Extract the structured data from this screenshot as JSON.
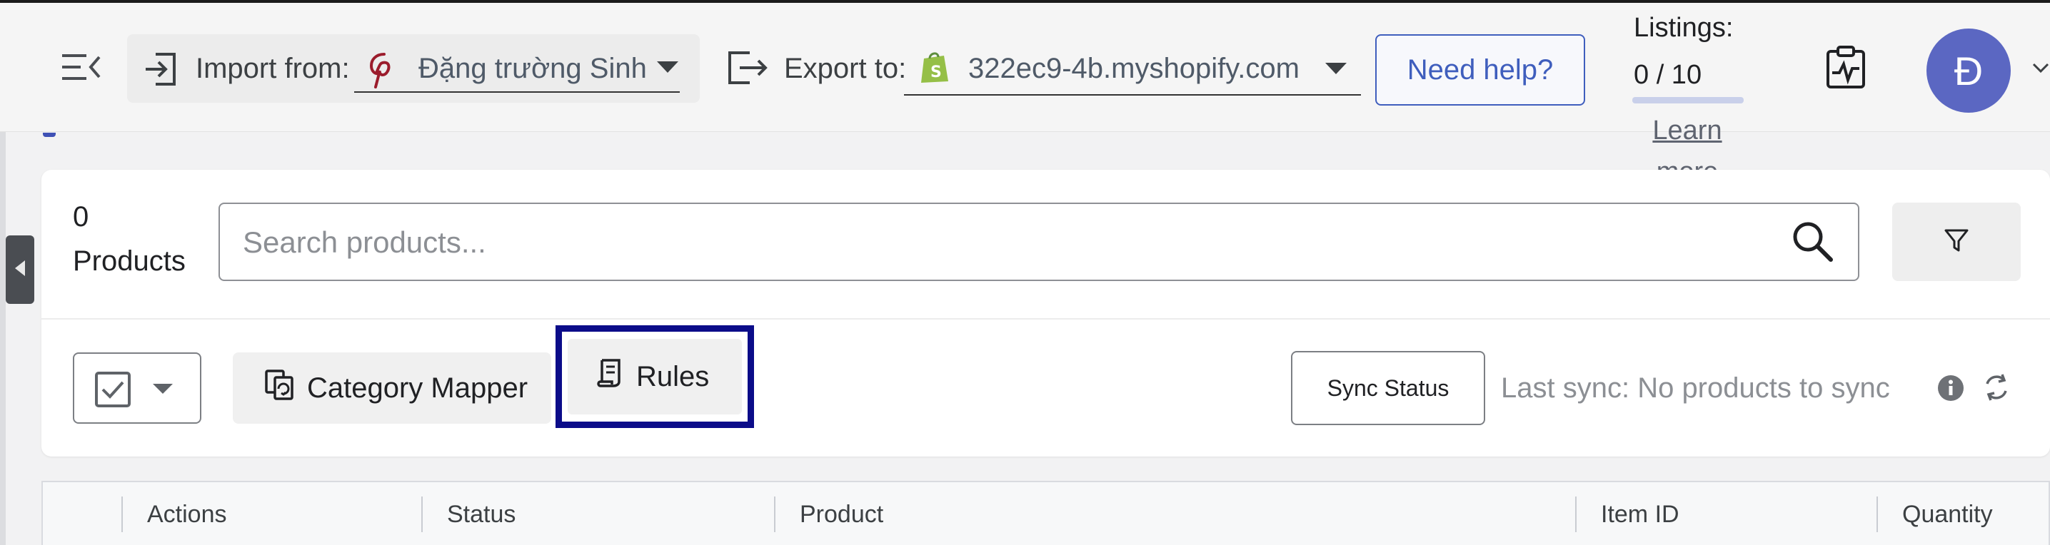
{
  "header": {
    "import_label": "Import from:",
    "import_source": "Đặng trường Sinh",
    "export_label": "Export to:",
    "export_target": "322ec9-4b.myshopify.com",
    "need_help_label": "Need help?",
    "listings_title": "Listings:",
    "listings_count": "0 / 10",
    "listings_progress": 0,
    "learn_more_label": "Learn more",
    "avatar_initial": "Đ"
  },
  "toolbar": {
    "product_count": "0",
    "products_label": "Products",
    "search_placeholder": "Search products...",
    "category_mapper_label": "Category Mapper",
    "rules_label": "Rules",
    "sync_status_label": "Sync Status",
    "last_sync_text": "Last sync: No products to sync"
  },
  "table": {
    "columns": [
      "Actions",
      "Status",
      "Product",
      "Item ID",
      "Quantity"
    ]
  },
  "colors": {
    "accent": "#5b67c2",
    "highlight_border": "#0b0c89",
    "link_blue": "#3f5ebd",
    "shopify_green": "#95bf47",
    "pinterest_red": "#9b1c2c"
  },
  "icons": {
    "menu": "menu-collapse-icon",
    "import": "import-icon",
    "export": "export-icon",
    "search": "search-icon",
    "filter": "filter-icon",
    "rules": "rules-doc-icon",
    "category_mapper": "category-mapper-icon",
    "info": "info-icon",
    "refresh": "refresh-icon",
    "activity": "activity-clipboard-icon"
  }
}
